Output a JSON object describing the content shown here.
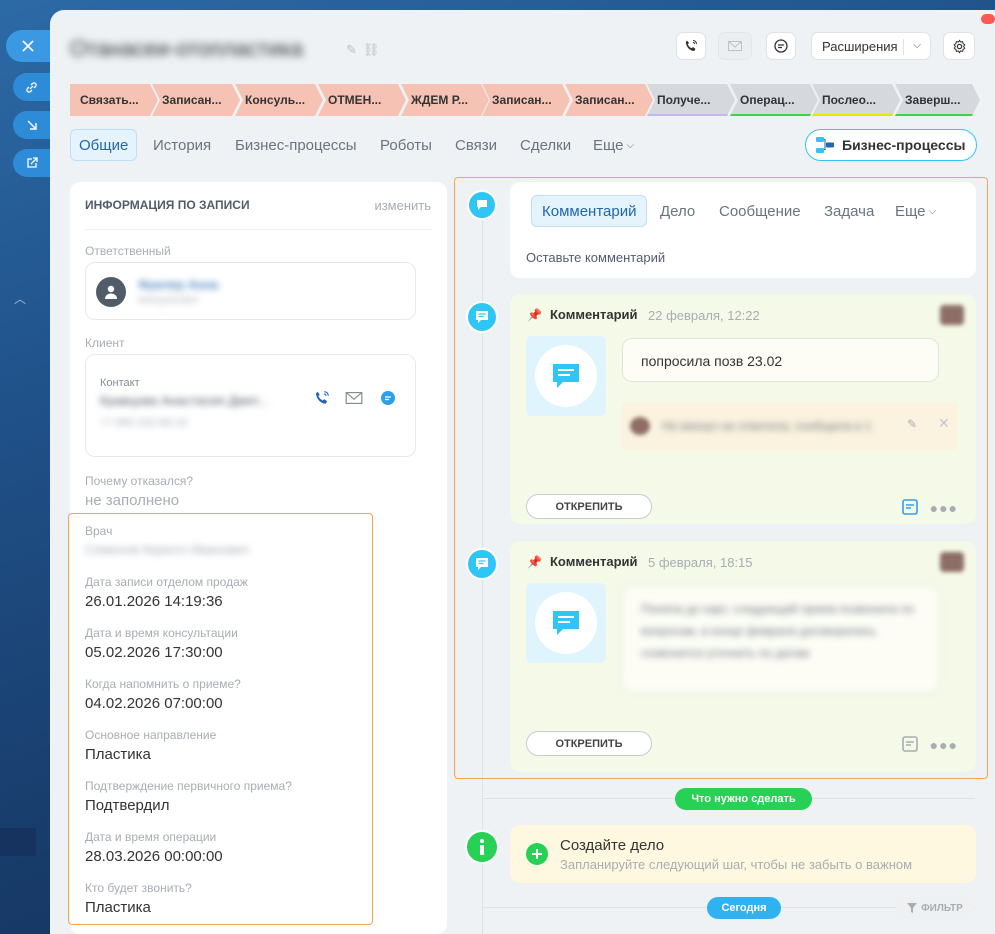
{
  "entity": {
    "title": "Отанасеи-отопластика"
  },
  "header": {
    "call_icon": "phone-icon",
    "mail_icon": "envelope-icon",
    "sync_icon": "chat-sync-icon",
    "extensions_label": "Расширения",
    "settings_icon": "gear-icon"
  },
  "stages": [
    {
      "label": "Связать...",
      "color": "#f5c2b4",
      "bar": ""
    },
    {
      "label": "Записан...",
      "color": "#f5c2b4",
      "bar": ""
    },
    {
      "label": "Консуль...",
      "color": "#f5c2b4",
      "bar": ""
    },
    {
      "label": "ОТМЕН...",
      "color": "#f5c2b4",
      "bar": ""
    },
    {
      "label": "ЖДЕМ Р...",
      "color": "#f5c2b4",
      "bar": ""
    },
    {
      "label": "Записан...",
      "color": "#f5c2b4",
      "bar": ""
    },
    {
      "label": "Записан...",
      "color": "#f5c2b4",
      "bar": ""
    },
    {
      "label": "Получе...",
      "color": "#d5d9de",
      "bar": "#c4b6ef"
    },
    {
      "label": "Операц...",
      "color": "#d5d9de",
      "bar": "#3bd44b"
    },
    {
      "label": "Послео...",
      "color": "#d5d9de",
      "bar": "#e6e600"
    },
    {
      "label": "Заверш...",
      "color": "#d5d9de",
      "bar": "#3bd44b"
    }
  ],
  "tabs": [
    "Общие",
    "История",
    "Бизнес-процессы",
    "Роботы",
    "Связи",
    "Сделки",
    "Еще"
  ],
  "bp_button": "Бизнес-процессы",
  "info": {
    "header": "ИНФОРМАЦИЯ ПО ЗАПИСИ",
    "edit": "изменить",
    "responsible_label": "Ответственный",
    "responsible_name": "Фрилер Анна",
    "responsible_role": "консультант",
    "client_label": "Клиент",
    "contact_label": "Контакт",
    "contact_name": "Кравцова Анастасия Дмит...",
    "contact_phone": "+7 965 232-96-19",
    "refuse_label": "Почему отказался?",
    "refuse_value": "не заполнено",
    "fields": [
      {
        "label": "Врач",
        "value": "Семенов Кирилл Иванович",
        "blur": true
      },
      {
        "label": "Дата записи отделом продаж",
        "value": "26.01.2026 14:19:36"
      },
      {
        "label": "Дата и время консультации",
        "value": "05.02.2026 17:30:00"
      },
      {
        "label": "Когда напомнить о приеме?",
        "value": "04.02.2026 07:00:00"
      },
      {
        "label": "Основное направление",
        "value": "Пластика"
      },
      {
        "label": "Подтверждение первичного приема?",
        "value": "Подтвердил"
      },
      {
        "label": "Дата и время операции",
        "value": "28.03.2026 00:00:00"
      },
      {
        "label": "Кто будет звонить?",
        "value": "Пластика"
      }
    ]
  },
  "editor": {
    "tabs": [
      "Комментарий",
      "Дело",
      "Сообщение",
      "Задача",
      "Еще"
    ],
    "placeholder": "Оставьте комментарий"
  },
  "comments": [
    {
      "title": "Комментарий",
      "date": "22 февраля, 12:22",
      "text": "попросила позв 23.02",
      "sub": "Не вязнул не ответила, сообщила в 1",
      "unpin": "ОТКРЕПИТЬ"
    },
    {
      "title": "Комментарий",
      "date": "5 февраля, 18:15",
      "text": "Поняла до карт, следующий прием позвонила по вопросам, в конце февраля договорились созвонится уточнить по датам",
      "unpin": "ОТКРЕПИТЬ"
    }
  ],
  "todo_pill": "Что нужно сделать",
  "todo": {
    "title": "Создайте дело",
    "subtitle": "Запланируйте следующий шаг, чтобы не забыть о важном"
  },
  "today_pill": "Сегодня",
  "filter_label": "ФИЛЬТР",
  "colors": {
    "accent": "#2fc6f6",
    "success": "#9dcf00",
    "pill_green": "#27d155",
    "orange_outline": "#f7a64b"
  }
}
